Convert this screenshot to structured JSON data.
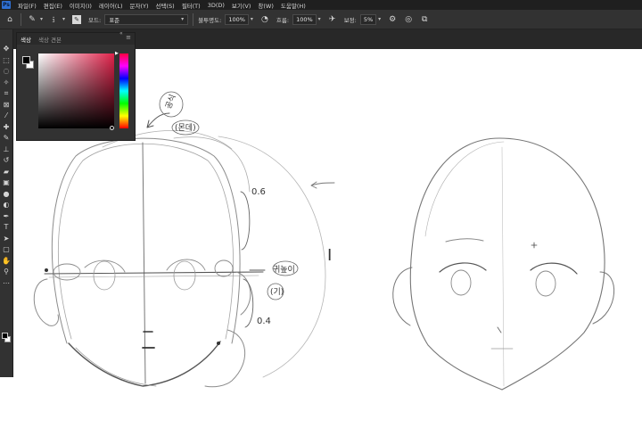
{
  "menu": {
    "logo": "Ps",
    "items": [
      "파일(F)",
      "편집(E)",
      "이미지(I)",
      "레이어(L)",
      "문자(Y)",
      "선택(S)",
      "필터(T)",
      "3D(D)",
      "보기(V)",
      "창(W)",
      "도움말(H)"
    ]
  },
  "options": {
    "brush_size": "3",
    "mode_label": "모드:",
    "mode_value": "표준",
    "opacity_label": "불투명도:",
    "opacity_value": "100%",
    "flow_label": "흐름:",
    "flow_value": "100%",
    "smoothing_label": "보정:",
    "smoothing_value": "5%"
  },
  "color_panel": {
    "tabs": [
      "색상",
      "색상 견본"
    ],
    "active_tab": "색상",
    "foreground_color": "#000000",
    "background_color": "#ffffff",
    "hue_color": "#e0224a"
  },
  "tools": [
    "move-icon",
    "marquee-icon",
    "lasso-icon",
    "magic-wand-icon",
    "crop-icon",
    "frame-icon",
    "eyedropper-icon",
    "healing-icon",
    "brush-icon",
    "stamp-icon",
    "history-brush-icon",
    "eraser-icon",
    "gradient-icon",
    "blur-icon",
    "dodge-icon",
    "pen-icon",
    "type-icon",
    "path-select-icon",
    "shape-icon",
    "hand-icon",
    "zoom-icon",
    "more-icon"
  ],
  "annotations": {
    "note_top_line1": "공식",
    "note_top_line2": "(몬데)",
    "ratio_upper": "0.6",
    "ratio_lower": "0.4",
    "ear_note_line1": "귀높이",
    "ear_note_line2": "(기)",
    "vertical_mark": "I"
  }
}
